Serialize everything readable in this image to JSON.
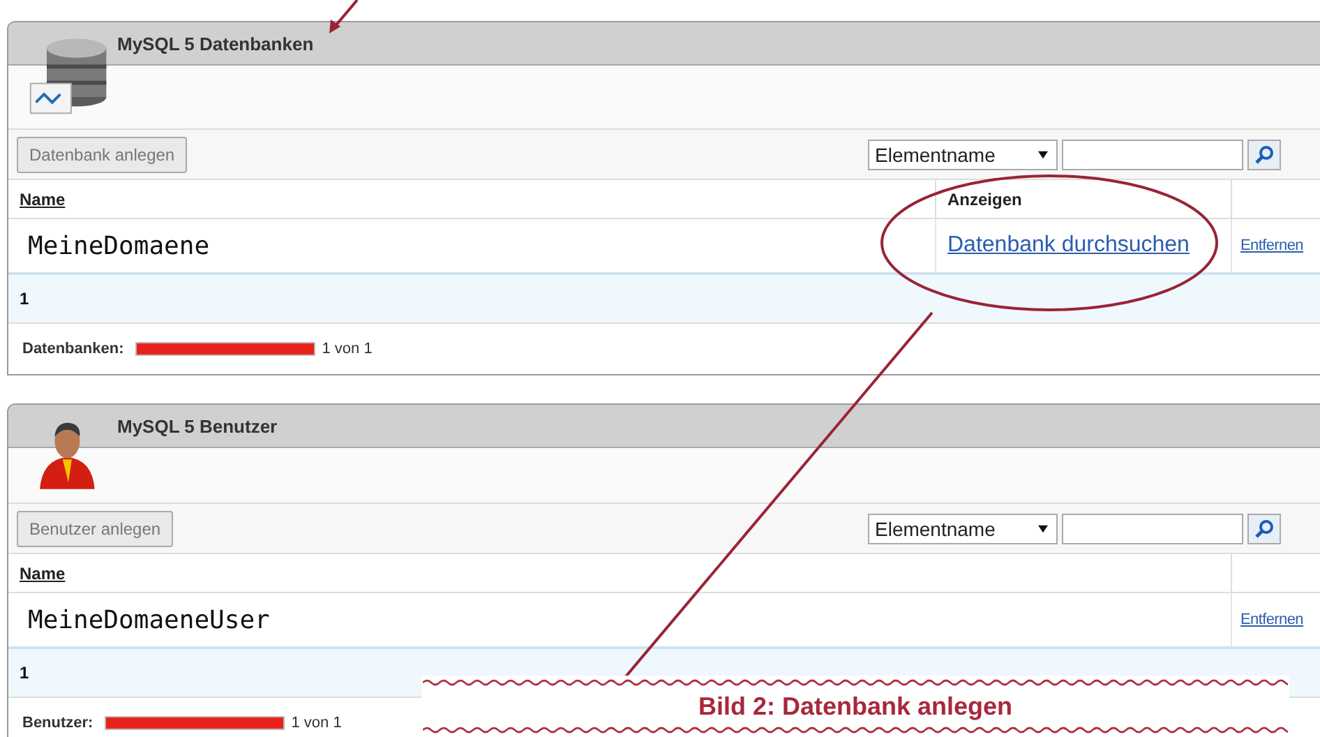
{
  "panels": [
    {
      "kind": "database",
      "title": "MySQL 5 Datenbanken",
      "create_button": "Datenbank anlegen",
      "filter": {
        "value": "Elementname"
      },
      "columns": [
        "Name",
        "Anzeigen"
      ],
      "rows": [
        {
          "name": "MeineDomaene",
          "show_link": "Datenbank durchsuchen",
          "remove_link": "Entfernen"
        }
      ],
      "count": "1",
      "footer": {
        "label": "Datenbanken:",
        "level": 1,
        "reading": "1 von 1"
      }
    },
    {
      "kind": "user",
      "title": "MySQL 5 Benutzer",
      "create_button": "Benutzer anlegen",
      "filter": {
        "value": "Elementname"
      },
      "columns": [
        "Name"
      ],
      "rows": [
        {
          "name": "MeineDomaeneUser",
          "remove_link": "Entfernen"
        }
      ],
      "count": "1",
      "footer": {
        "label": "Benutzer:",
        "level": 1,
        "reading": "1 von 1"
      }
    }
  ],
  "annotation": {
    "caption": "Bild 2: Datenbank anlegen"
  }
}
